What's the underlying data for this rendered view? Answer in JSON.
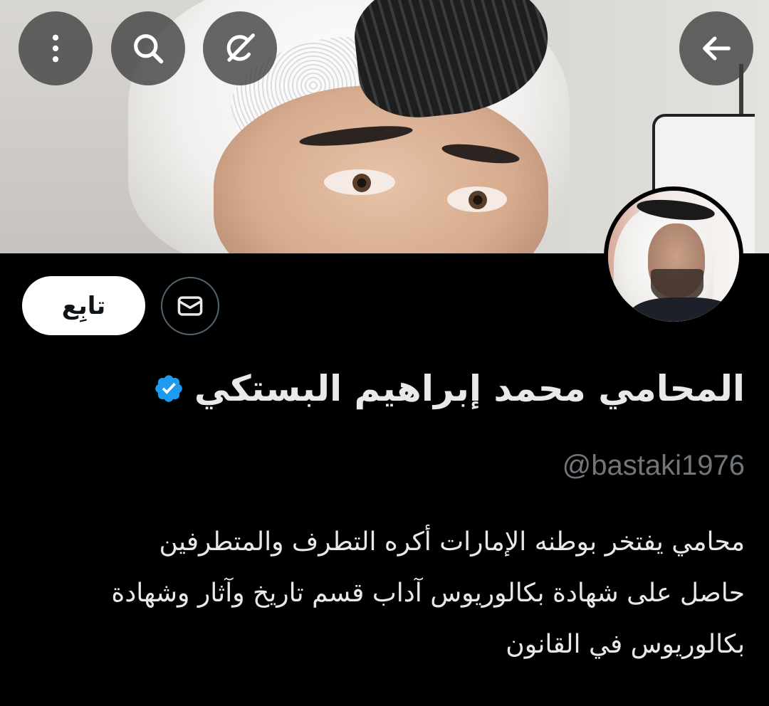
{
  "header": {
    "more_icon": "more-vertical-icon",
    "search_icon": "search-icon",
    "grok_icon": "grok-icon",
    "back_icon": "arrow-left-icon"
  },
  "profile": {
    "display_name": "المحامي محمد إبراهيم البستكي",
    "verified_icon": "verified-badge-icon",
    "verified_color": "#1d9bf0",
    "handle": "@bastaki1976",
    "bio_lines": [
      "محامي يفتخر بوطنه الإمارات أكره التطرف والمتطرفين",
      "حاصل على شهادة بكالوريوس آداب قسم تاريخ وآثار وشهادة",
      "بكالوريوس في القانون"
    ]
  },
  "actions": {
    "follow_label": "تابِع",
    "message_icon": "envelope-icon"
  }
}
